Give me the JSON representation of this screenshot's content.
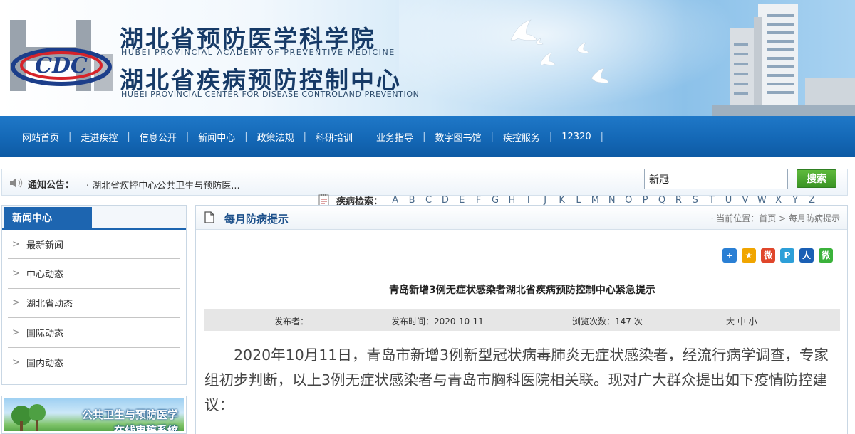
{
  "header": {
    "title_cn_1": "湖北省预防医学科学院",
    "title_en_1": "HUBEI PROVINCIAL ACADEMY OF PREVENTIVE MEDICINE",
    "title_cn_2": "湖北省疾病预防控制中心",
    "title_en_2": "HUBEI PROVINCIAL CENTER FOR DISEASE CONTROLAND PREVENTION",
    "logo_text": "CDC"
  },
  "nav": {
    "items": [
      {
        "label": "网站首页"
      },
      {
        "label": "走进疾控"
      },
      {
        "label": "信息公开"
      },
      {
        "label": "新闻中心"
      },
      {
        "label": "政策法规"
      },
      {
        "label": "科研培训"
      },
      {
        "label": "业务指导"
      },
      {
        "label": "数字图书馆"
      },
      {
        "label": "疾控服务"
      },
      {
        "label": "12320"
      }
    ]
  },
  "notice": {
    "label": "通知公告：",
    "text": "· 湖北省疾控中心公共卫生与预防医..."
  },
  "search": {
    "value": "新冠",
    "button_label": "搜索"
  },
  "disease_search": {
    "label": "疾病检索：",
    "letters": [
      "A",
      "B",
      "C",
      "D",
      "E",
      "F",
      "G",
      "H",
      "I",
      "J",
      "K",
      "L",
      "M",
      "N",
      "O",
      "P",
      "Q",
      "R",
      "S",
      "T",
      "U",
      "V",
      "W",
      "X",
      "Y",
      "Z"
    ]
  },
  "sidebar": {
    "title": "新闻中心",
    "items": [
      {
        "label": "最新新闻"
      },
      {
        "label": "中心动态"
      },
      {
        "label": "湖北省动态"
      },
      {
        "label": "国际动态"
      },
      {
        "label": "国内动态"
      }
    ],
    "promo": {
      "line1": "公共卫生与预防医学",
      "line2": "在线审稿系统"
    }
  },
  "main": {
    "section_title": "每月防病提示",
    "breadcrumb": "· 当前位置：首页 > 每月防病提示",
    "share_icons": [
      {
        "name": "plus-share-icon",
        "color": "#2a7fd4",
        "glyph": "+"
      },
      {
        "name": "qzone-share-icon",
        "color": "#f0a500",
        "glyph": "★"
      },
      {
        "name": "weibo-share-icon",
        "color": "#e0462b",
        "glyph": "微"
      },
      {
        "name": "tencent-share-icon",
        "color": "#2d9fd8",
        "glyph": "P"
      },
      {
        "name": "renren-share-icon",
        "color": "#1a5fb4",
        "glyph": "人"
      },
      {
        "name": "wechat-share-icon",
        "color": "#3bb23b",
        "glyph": "微"
      }
    ],
    "article": {
      "title": "青岛新增3例无症状感染者湖北省疾病预防控制中心紧急提示",
      "publisher_label": "发布者：",
      "publish_time": "发布时间：2020-10-11",
      "views": "浏览次数：147 次",
      "font_size_controls": "大 中 小",
      "body": "2020年10月11日，青岛市新增3例新型冠状病毒肺炎无症状感染者，经流行病学调查，专家组初步判断，以上3例无症状感染者与青岛市胸科医院相关联。现对广大群众提出如下疫情防控建议："
    }
  }
}
